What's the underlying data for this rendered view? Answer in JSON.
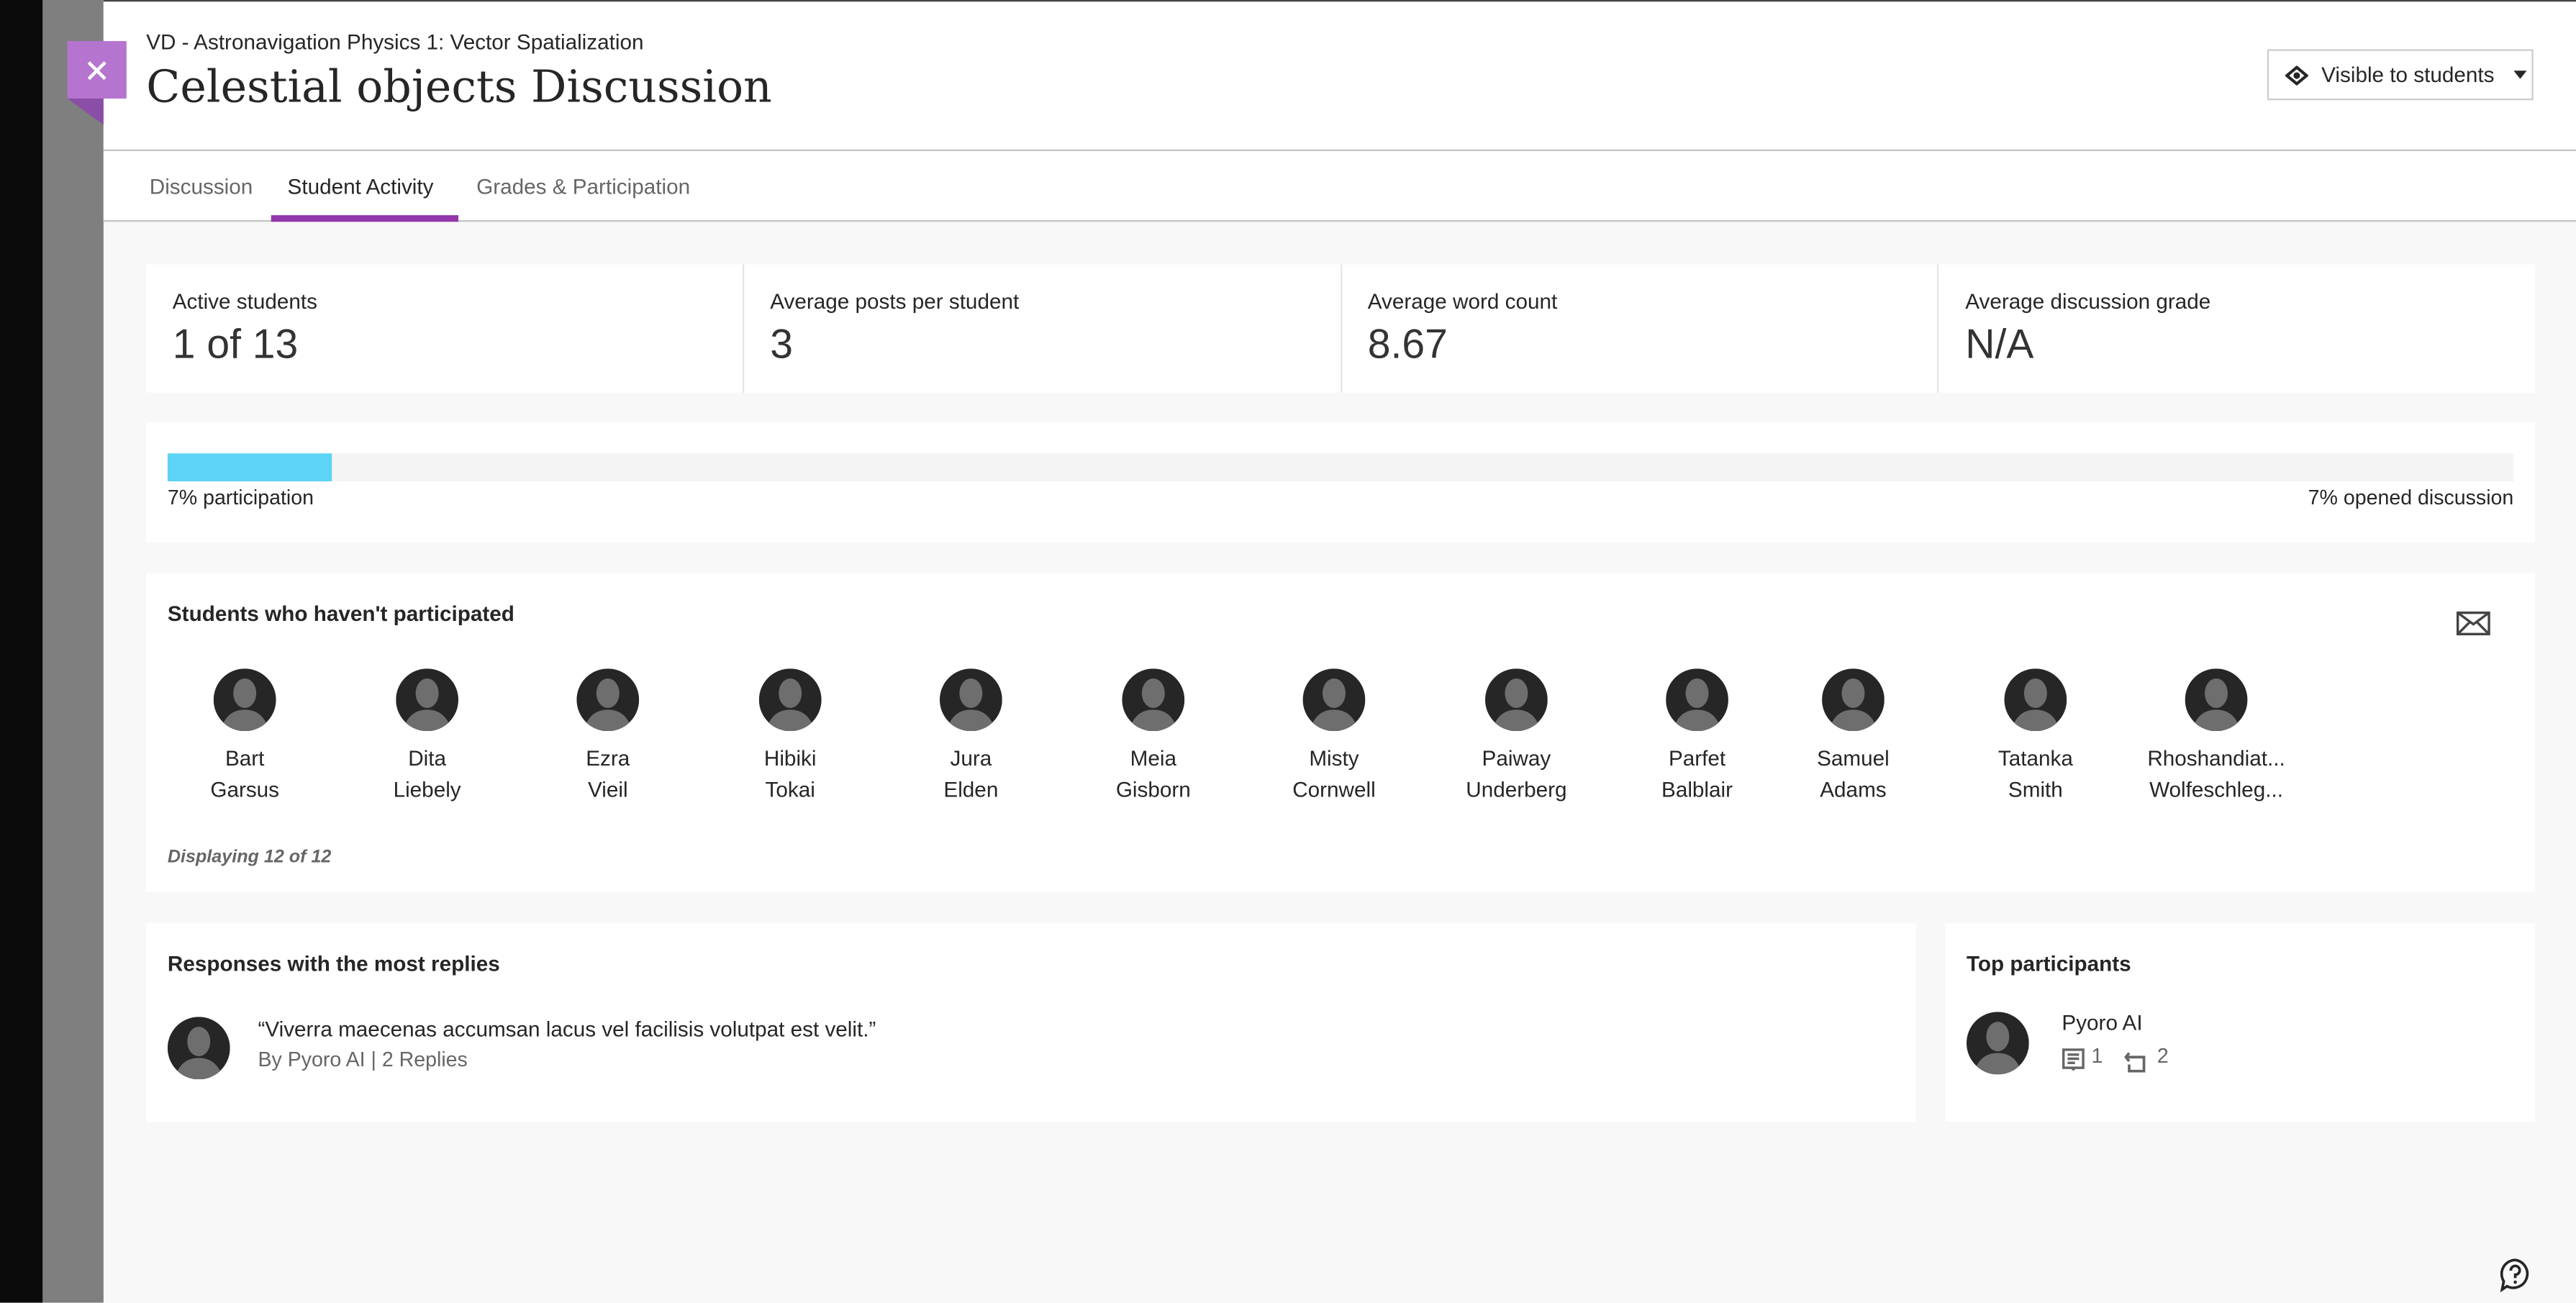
{
  "header": {
    "breadcrumb": "VD - Astronavigation Physics 1: Vector Spatialization",
    "title": "Celestial objects Discussion",
    "visibility": "Visible to students"
  },
  "tabs": [
    {
      "label": "Discussion"
    },
    {
      "label": "Student Activity",
      "active": true
    },
    {
      "label": "Grades & Participation"
    }
  ],
  "stats": [
    {
      "label": "Active students",
      "value": "1 of 13"
    },
    {
      "label": "Average posts per student",
      "value": "3"
    },
    {
      "label": "Average word count",
      "value": "8.67"
    },
    {
      "label": "Average discussion grade",
      "value": "N/A"
    }
  ],
  "participation": {
    "percent": 7,
    "participation_label": "7% participation",
    "opened_label": "7% opened discussion"
  },
  "not_participated": {
    "heading": "Students who haven't participated",
    "displaying": "Displaying 12 of 12",
    "students": [
      {
        "first": "Bart",
        "last": "Garsus"
      },
      {
        "first": "Dita",
        "last": "Liebely"
      },
      {
        "first": "Ezra",
        "last": "Vieil"
      },
      {
        "first": "Hibiki",
        "last": "Tokai"
      },
      {
        "first": "Jura",
        "last": "Elden"
      },
      {
        "first": "Meia",
        "last": "Gisborn"
      },
      {
        "first": "Misty",
        "last": "Cornwell"
      },
      {
        "first": "Paiway",
        "last": "Underberg"
      },
      {
        "first": "Parfet",
        "last": "Balblair"
      },
      {
        "first": "Samuel",
        "last": "Adams"
      },
      {
        "first": "Tatanka",
        "last": "Smith"
      },
      {
        "first": "Rhoshandiat...",
        "last": "Wolfeschleg..."
      }
    ]
  },
  "responses": {
    "heading": "Responses with the most replies",
    "items": [
      {
        "quote": "“Viverra maecenas accumsan lacus vel facilisis volutpat est velit.”",
        "meta": "By Pyoro AI | 2 Replies"
      }
    ]
  },
  "top_participants": {
    "heading": "Top participants",
    "items": [
      {
        "name": "Pyoro AI",
        "posts": "1",
        "replies": "2"
      }
    ]
  },
  "colors": {
    "accent": "#9237ad",
    "close_button": "#b574ce",
    "progress": "#5dd3f5"
  },
  "icons": {
    "close": "close-icon",
    "visibility": "eye-icon",
    "dropdown": "caret-down-icon",
    "mail": "mail-icon",
    "help": "help-icon",
    "posts": "post-icon",
    "replies": "reply-icon"
  }
}
